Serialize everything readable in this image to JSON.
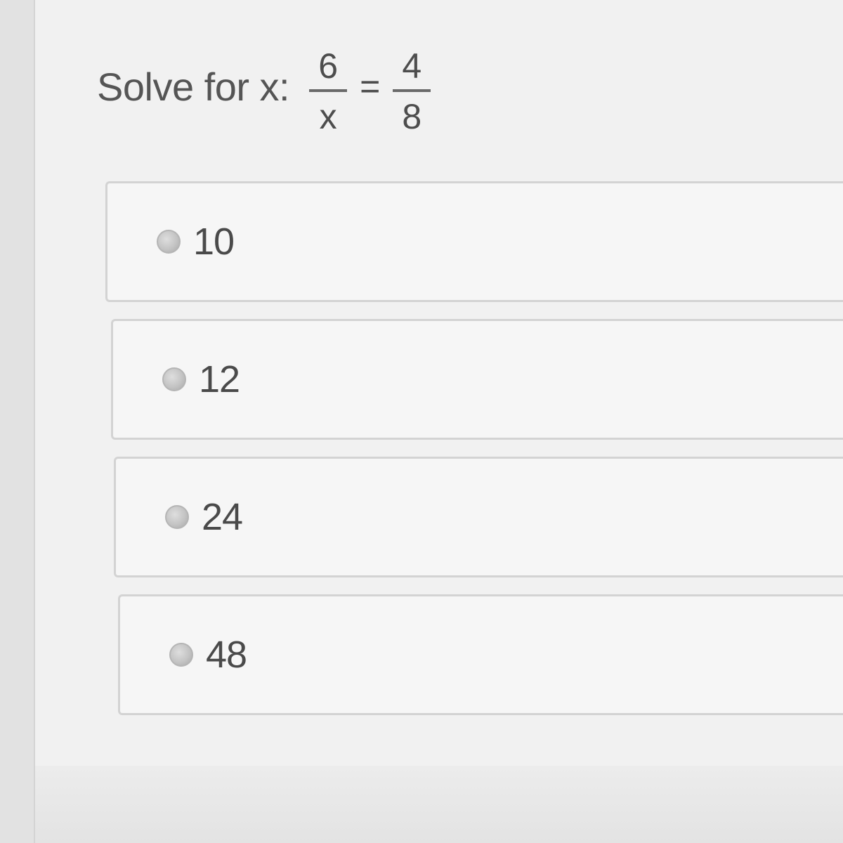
{
  "question": {
    "label": "Solve for x:",
    "left_fraction": {
      "numerator": "6",
      "denominator": "x"
    },
    "equals": "=",
    "right_fraction": {
      "numerator": "4",
      "denominator": "8"
    }
  },
  "options": [
    {
      "label": "10",
      "selected": false
    },
    {
      "label": "12",
      "selected": false
    },
    {
      "label": "24",
      "selected": false
    },
    {
      "label": "48",
      "selected": false
    }
  ],
  "colors": {
    "background": "#e9e9e9",
    "option_background": "#f6f6f6",
    "option_border": "#d3d3d3",
    "text": "#4a4a4a"
  }
}
